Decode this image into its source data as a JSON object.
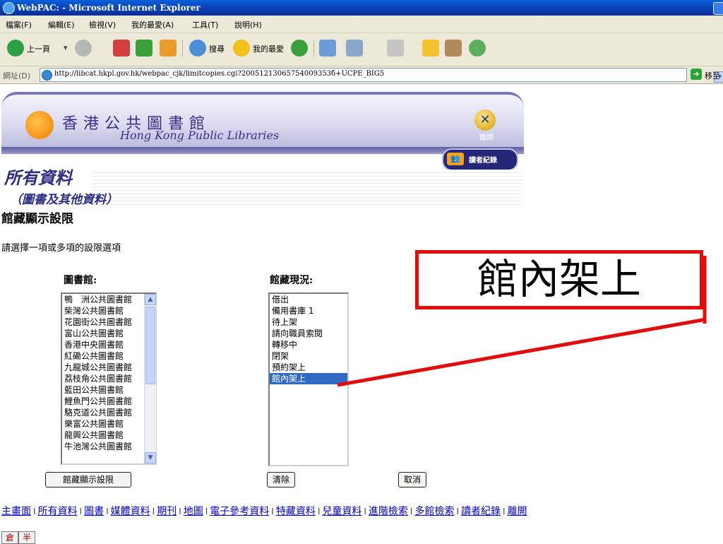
{
  "window": {
    "title": "WebPAC: - Microsoft Internet Explorer"
  },
  "menu": [
    "檔案(F)",
    "編輯(E)",
    "檢視(V)",
    "我的最愛(A)",
    "工具(T)",
    "說明(H)"
  ],
  "toolbar": {
    "back": "上一頁",
    "search": "搜尋",
    "favorites": "我的最愛"
  },
  "address": {
    "label": "網址(D)",
    "url": "http://libcat.hkpl.gov.hk/webpac_cjk/limitcopies.cgi?20051213065754009353б+UCPE_BIG5",
    "go": "移至"
  },
  "banner": {
    "name_zh": "香港公共圖書館",
    "name_en": "Hong Kong Public Libraries",
    "exit": "離開",
    "reader_record": "讀者紀錄",
    "section_title": "所有資料",
    "section_subtitle": "（圖書及其他資料）"
  },
  "page": {
    "title": "館藏顯示設限",
    "instruction": "請選擇一項或多項的設限選項"
  },
  "library": {
    "header": "圖書館:",
    "options": [
      "鴨　洲公共圖書館",
      "柴灣公共圖書館",
      "花園街公共圖書館",
      "富山公共圖書館",
      "香港中央圖書館",
      "紅磡公共圖書館",
      "九龍城公共圖書館",
      "荔枝角公共圖書館",
      "藍田公共圖書館",
      "鯉魚門公共圖書館",
      "駱克道公共圖書館",
      "樂富公共圖書館",
      "龍興公共圖書館",
      "牛池灣公共圖書館"
    ]
  },
  "status": {
    "header": "館藏現況:",
    "options": [
      "借出",
      "備用書庫 1",
      "待上架",
      "請向職員索閱",
      "轉移中",
      "閉架",
      "預約架上",
      "館內架上"
    ],
    "selected_index": 7
  },
  "buttons": {
    "submit": "館藏顯示設限",
    "clear": "清除",
    "cancel": "取消"
  },
  "annotation": {
    "text": "館內架上",
    "color": "#e10d0d"
  },
  "footer": {
    "links": [
      "主畫面",
      "所有資料",
      "圖書",
      "媒體資料",
      "期刊",
      "地圖",
      "電子參考資料",
      "特藏資料",
      "兒童資料",
      "進階檢索",
      "多館檢索",
      "讀者紀錄",
      "離開"
    ],
    "separator": "I"
  },
  "ime": [
    "倉",
    "半"
  ]
}
